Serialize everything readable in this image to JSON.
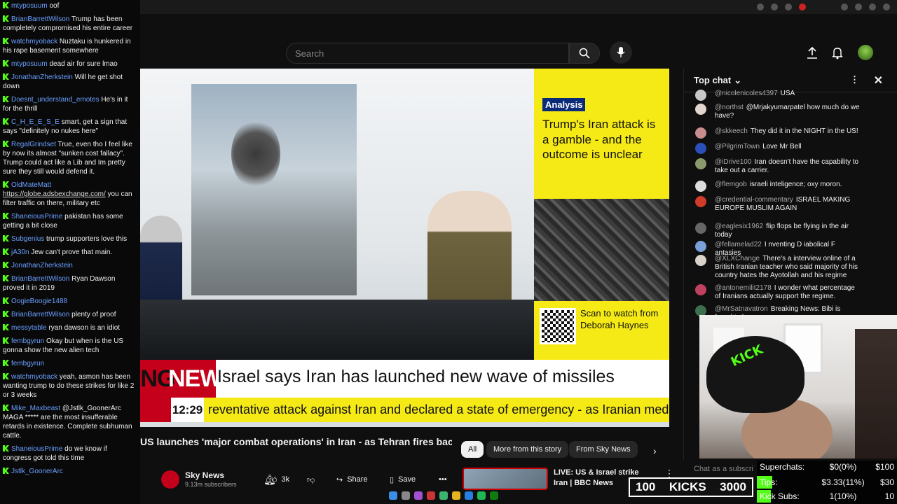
{
  "left_chat": [
    {
      "user": "mtyposuum",
      "text": "oof"
    },
    {
      "user": "BrianBarrettWilson",
      "text": "Trump has been completely compromised his entire career"
    },
    {
      "user": "watchmyoback",
      "text": "Nuztaku is hunkered in his rape basement somewhere"
    },
    {
      "user": "mtyposuum",
      "text": "dead air for sure lmao"
    },
    {
      "user": "JonathanZherkstein",
      "text": "Will he get shot down"
    },
    {
      "user": "Doesnt_understand_emotes",
      "text": "He's in it for the thrill"
    },
    {
      "user": "C_H_E_E_S_E",
      "text": "smart, get a sign that says \"definitely no nukes here\""
    },
    {
      "user": "RegalGrindset",
      "text": "True, even tho I feel like by now its almost \"sunken cost fallacy\". Trump could act like a Lib and Im pretty sure they still would defend it."
    },
    {
      "user": "OldMateMatt",
      "link": "https://globe.adsbexchange.com/",
      "text": "you can filter traffic on there, military etc"
    },
    {
      "user": "ShaneiousPrime",
      "text": "pakistan has some getting a bit close"
    },
    {
      "user": "Subgenius",
      "text": "trump supporters love this"
    },
    {
      "user": "jA30n",
      "text": "Jew can't prove that main."
    },
    {
      "user": "JonathanZherkstein",
      "text": ""
    },
    {
      "user": "BrianBarrettWilson",
      "text": "Ryan Dawson proved it in 2019"
    },
    {
      "user": "OogieBoogie1488",
      "text": ""
    },
    {
      "user": "BrianBarrettWilson",
      "text": "plenty of proof"
    },
    {
      "user": "messytable",
      "text": "ryan dawson is an idiot"
    },
    {
      "user": "fembgyrun",
      "text": "Okay but when is the US gonna show the new alien tech"
    },
    {
      "user": "fembgyrun",
      "text": ""
    },
    {
      "user": "watchmyoback",
      "text": "yeah, asmon has been wanting trump to do these strikes for like 2 or 3 weeks"
    },
    {
      "user": "Mike_Maxbeast",
      "text": "@Jstlk_GoonerArc MAGA ***** are the most insufferable retards in existence. Complete subhuman cattle."
    },
    {
      "user": "ShaneiousPrime",
      "text": "do we know if congress got told this time"
    },
    {
      "user": "Jstlk_GoonerArc",
      "text": ""
    }
  ],
  "header": {
    "search_placeholder": "Search"
  },
  "video": {
    "analysis_badge": "Analysis",
    "panel_title": "Trump's Iran attack is a gamble - and the outcome is unclear",
    "scan_text": "Scan to watch from Deborah Haynes",
    "breaking_label_a": "BREAKING",
    "breaking_label_b": "NEWS",
    "headline": "Israel says Iran has launched new wave of missiles",
    "clock": "12:29",
    "ticker": "reventative attack against Iran and declared a state of emergency - as Iranian media re"
  },
  "below": {
    "title": "US launches 'major combat operations' in Iran - as Tehran fires back at US bases in Middle East",
    "channel": "Sky News",
    "subscribers": "9.13m subscribers",
    "likes": "3k",
    "share": "Share",
    "save": "Save",
    "chips": [
      "All",
      "More from this story",
      "From Sky News"
    ],
    "related_title": "LIVE: US & Israel strike Iran | BBC News"
  },
  "right_chat": {
    "header": "Top chat",
    "messages": [
      {
        "user": "@nicolenicoles4397",
        "text": "USA"
      },
      {
        "user": "@northst",
        "text": "@Mrjakyumarpatel how much do we have?"
      },
      {
        "user": "@skkeech",
        "text": "They did it in the NIGHT in the US!"
      },
      {
        "user": "@PilgrimTown",
        "text": "Love Mr Bell"
      },
      {
        "user": "@iDrive100",
        "text": "Iran doesn't have the capability to take out a carrier."
      },
      {
        "user": "@flemgob",
        "text": "israeli inteligence; oxy moron."
      },
      {
        "user": "@credential-commentary",
        "text": "ISRAEL MAKING EUROPE MUSLIM AGAIN"
      },
      {
        "user": "@eaglesix1962",
        "text": "flip flops be flying in the air today"
      },
      {
        "user": "@fellamelad22",
        "text": "I nventing D iabolical F antasies"
      },
      {
        "user": "@XLXChange",
        "text": "There's a interview online of a British Iranian teacher who said majority of his country hates the Ayotollah and his regime"
      },
      {
        "user": "@antonemilit2178",
        "text": "I wonder what percentage of Iranians actually support the regime."
      },
      {
        "user": "@MrSatnavatron",
        "text": "Breaking News: Bibi is found to be"
      }
    ],
    "input_placeholder": "Chat as a subscri"
  },
  "stats": {
    "superchats_label": "Superchats:",
    "superchats_value": "$0(0%)",
    "superchats_goal": "$100",
    "superchats_progress": 0,
    "tips_label": "Tips:",
    "tips_value": "$3.33(11%)",
    "tips_goal": "$30",
    "tips_progress": 0.11,
    "subs_label": "Kick Subs:",
    "subs_value": "1(10%)",
    "subs_goal": "10",
    "subs_progress": 0.1,
    "kicks_left": "100",
    "kicks_label": "KICKS",
    "kicks_right": "3000"
  },
  "colors": {
    "kick_green": "#53fc18",
    "sky_yellow": "#f5ea16",
    "sky_red": "#c4001a"
  }
}
